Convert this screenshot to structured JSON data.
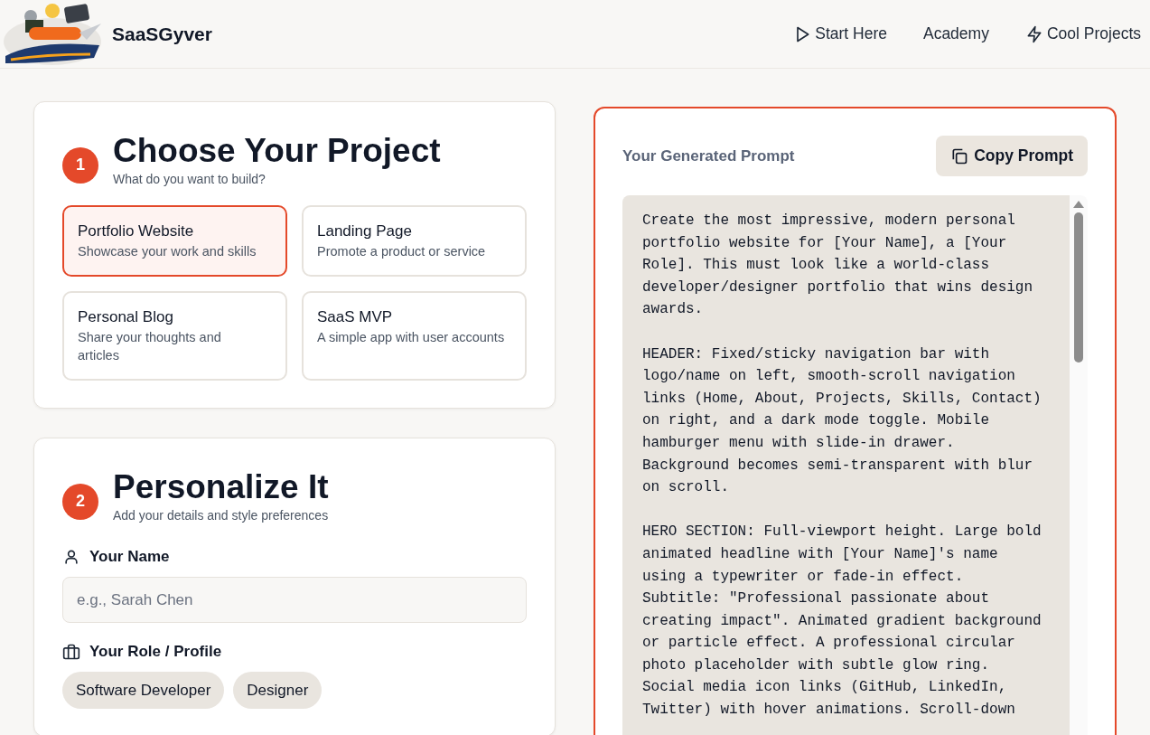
{
  "header": {
    "brand": "SaaSGyver",
    "nav": [
      {
        "kind": "play",
        "label": "Start Here"
      },
      {
        "kind": "plain",
        "label": "Academy"
      },
      {
        "kind": "bolt",
        "label": "Cool Projects"
      }
    ]
  },
  "steps": [
    {
      "number": "1",
      "title": "Choose Your Project",
      "subtitle": "What do you want to build?",
      "options": [
        {
          "title": "Portfolio Website",
          "description": "Showcase your work and skills",
          "selected": true
        },
        {
          "title": "Landing Page",
          "description": "Promote a product or service",
          "selected": false
        },
        {
          "title": "Personal Blog",
          "description": "Share your thoughts and articles",
          "selected": false
        },
        {
          "title": "SaaS MVP",
          "description": "A simple app with user accounts",
          "selected": false
        }
      ]
    },
    {
      "number": "2",
      "title": "Personalize It",
      "subtitle": "Add your details and style preferences",
      "fields": [
        {
          "kind": "text",
          "label": "Your Name",
          "placeholder": "e.g., Sarah Chen"
        },
        {
          "kind": "chips",
          "label": "Your Role / Profile",
          "chips": [
            "Software Developer",
            "Designer"
          ]
        }
      ]
    }
  ],
  "prompt": {
    "title": "Your Generated Prompt",
    "button": "Copy Prompt",
    "text": "Create the most impressive, modern personal portfolio website for [Your Name], a [Your Role]. This must look like a world-class developer/designer portfolio that wins design awards.\n\nHEADER: Fixed/sticky navigation bar with logo/name on left, smooth-scroll navigation links (Home, About, Projects, Skills, Contact) on right, and a dark mode toggle. Mobile hamburger menu with slide-in drawer. Background becomes semi-transparent with blur on scroll.\n\nHERO SECTION: Full-viewport height. Large bold animated headline with [Your Name]'s name using a typewriter or fade-in effect. Subtitle: \"Professional passionate about creating impact\". Animated gradient background or particle effect. A professional circular photo placeholder with subtle glow ring. Social media icon links (GitHub, LinkedIn, Twitter) with hover animations. Scroll-down"
  }
}
